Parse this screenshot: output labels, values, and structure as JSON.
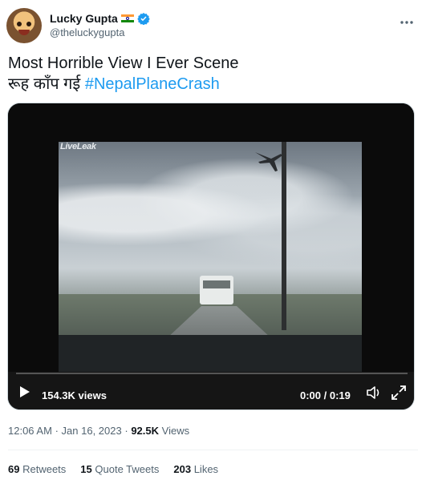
{
  "author": {
    "display_name": "Lucky Gupta",
    "handle": "@theluckygupta",
    "flag_icon": "india-flag-icon",
    "verified_icon": "verified-badge-icon"
  },
  "tweet": {
    "line1": "Most Horrible View I Ever Scene",
    "line2_text": "रूह काँप गई",
    "hashtag": "#NepalPlaneCrash"
  },
  "video": {
    "watermark": "LiveLeak",
    "views": "154.3K views",
    "time": "0:00 / 0:19",
    "progress": 0
  },
  "meta": {
    "time": "12:06 AM",
    "separator": "·",
    "date": "Jan 16, 2023",
    "views_count": "92.5K",
    "views_label": "Views"
  },
  "stats": {
    "retweets_count": "69",
    "retweets_label": "Retweets",
    "quotes_count": "15",
    "quotes_label": "Quote Tweets",
    "likes_count": "203",
    "likes_label": "Likes"
  },
  "colors": {
    "link": "#1d9bf0",
    "secondary_text": "#536471",
    "verified": "#1d9bf0"
  }
}
